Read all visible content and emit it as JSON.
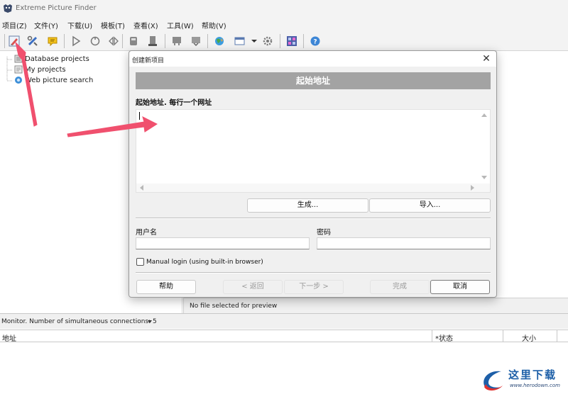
{
  "window": {
    "title": "Extreme Picture Finder"
  },
  "menu": {
    "items": [
      "项目(Z)",
      "文件(Y)",
      "下载(U)",
      "模板(T)",
      "查看(X)",
      "工具(W)",
      "帮助(V)"
    ]
  },
  "toolbar": {
    "buttons": [
      "new-project-icon",
      "edit-project-icon",
      "comment-icon",
      "play-icon",
      "stop-icon",
      "step-icon",
      "database-icon",
      "save-icon",
      "flag-icon",
      "flag-alt-icon",
      "globe-icon",
      "view-icon",
      "settings-icon",
      "picture-grid-icon",
      "help-icon"
    ]
  },
  "tree": {
    "items": [
      {
        "label": "Database projects",
        "icon": "database-icon"
      },
      {
        "label": "My projects",
        "icon": "folder-icon"
      },
      {
        "label": "Web picture search",
        "icon": "globe-icon"
      }
    ]
  },
  "preview": {
    "status": "No file selected for preview"
  },
  "monitor": {
    "text": "Monitor. Number of simultaneous connections: 5"
  },
  "grid": {
    "columns": [
      "地址",
      "*状态",
      "大小"
    ]
  },
  "dialog": {
    "title": "创建新项目",
    "close_glyph": "✕",
    "banner": "起始地址",
    "url_label": "起始地址. 每行一个网址",
    "url_value": "",
    "generate_label": "生成...",
    "import_label": "导入...",
    "username_label": "用户名",
    "password_label": "密码",
    "username_value": "",
    "password_value": "",
    "manual_login_label": "Manual login (using built-in browser)",
    "manual_login_checked": false,
    "help_label": "帮助",
    "back_label": "< 返回",
    "next_label": "下一步 >",
    "finish_label": "完成",
    "cancel_label": "取消"
  },
  "watermark": {
    "title": "这里下载",
    "url": "www.herodown.com"
  },
  "colors": {
    "banner": "#a3a3a3",
    "annotation_arrow": "#f0506e",
    "watermark_blue": "#1d5fa8",
    "watermark_red": "#e0322f"
  }
}
